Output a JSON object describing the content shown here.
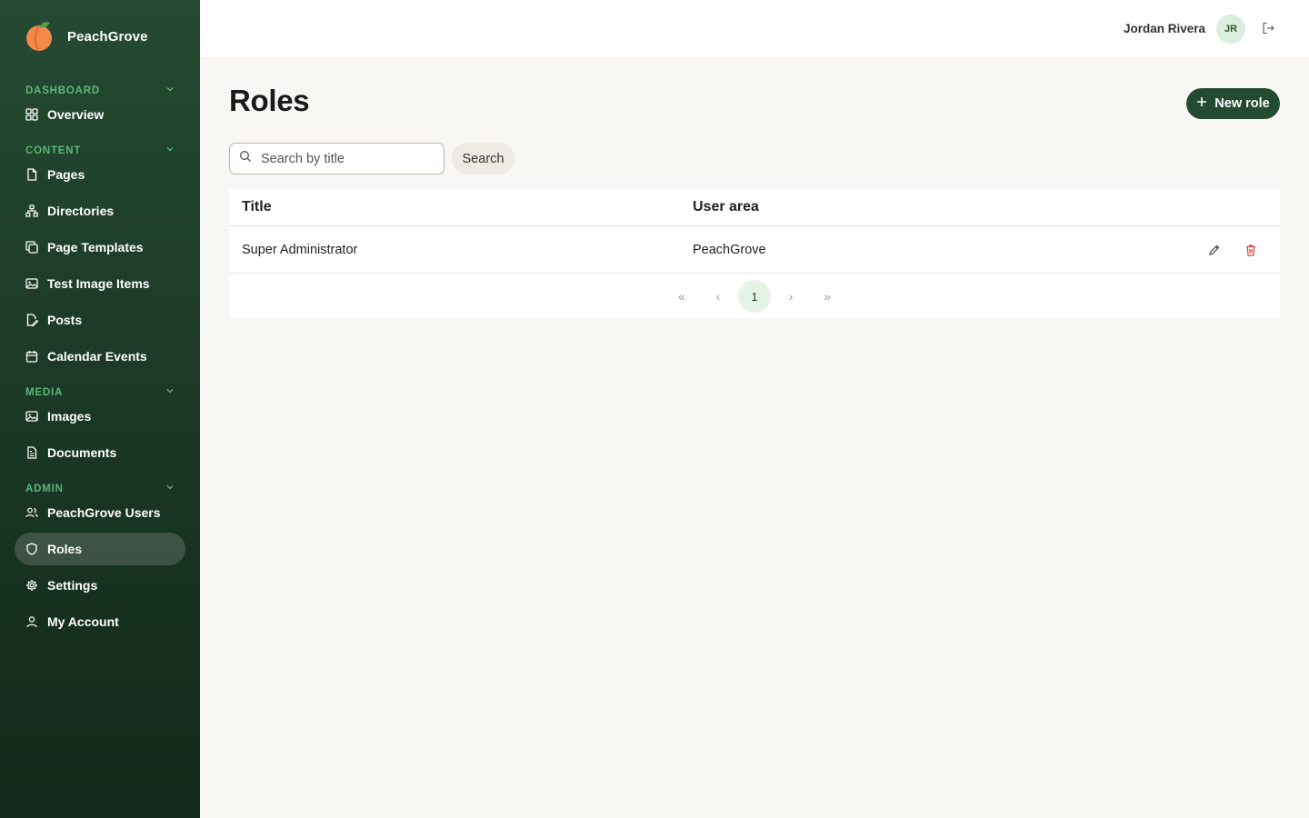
{
  "brand": {
    "name": "PeachGrove"
  },
  "colors": {
    "sidebar": "#1c3a27",
    "accent": "#254a32",
    "section_label": "#5cb877",
    "danger": "#d6423f"
  },
  "sidebar": {
    "sections": [
      {
        "label": "DASHBOARD",
        "items": [
          {
            "label": "Overview",
            "icon": "grid-icon"
          }
        ]
      },
      {
        "label": "CONTENT",
        "items": [
          {
            "label": "Pages",
            "icon": "file-icon"
          },
          {
            "label": "Directories",
            "icon": "sitemap-icon"
          },
          {
            "label": "Page Templates",
            "icon": "copy-icon"
          },
          {
            "label": "Test Image Items",
            "icon": "image-icon"
          },
          {
            "label": "Posts",
            "icon": "file-edit-icon"
          },
          {
            "label": "Calendar Events",
            "icon": "calendar-icon"
          }
        ]
      },
      {
        "label": "MEDIA",
        "items": [
          {
            "label": "Images",
            "icon": "image-icon"
          },
          {
            "label": "Documents",
            "icon": "file-text-icon"
          }
        ]
      },
      {
        "label": "ADMIN",
        "items": [
          {
            "label": "PeachGrove Users",
            "icon": "users-icon"
          },
          {
            "label": "Roles",
            "icon": "shield-icon",
            "active": true
          },
          {
            "label": "Settings",
            "icon": "gear-icon"
          },
          {
            "label": "My Account",
            "icon": "user-icon"
          }
        ]
      }
    ]
  },
  "header": {
    "user_name": "Jordan Rivera",
    "avatar_initials": "JR"
  },
  "main": {
    "title": "Roles",
    "new_button": "New role",
    "search": {
      "placeholder": "Search by title",
      "value": "",
      "button": "Search"
    },
    "table": {
      "columns": [
        "Title",
        "User area"
      ],
      "rows": [
        {
          "title": "Super Administrator",
          "user_area": "PeachGrove"
        }
      ]
    },
    "pagination": {
      "first": "«",
      "prev": "‹",
      "current": "1",
      "next": "›",
      "last": "»"
    }
  }
}
